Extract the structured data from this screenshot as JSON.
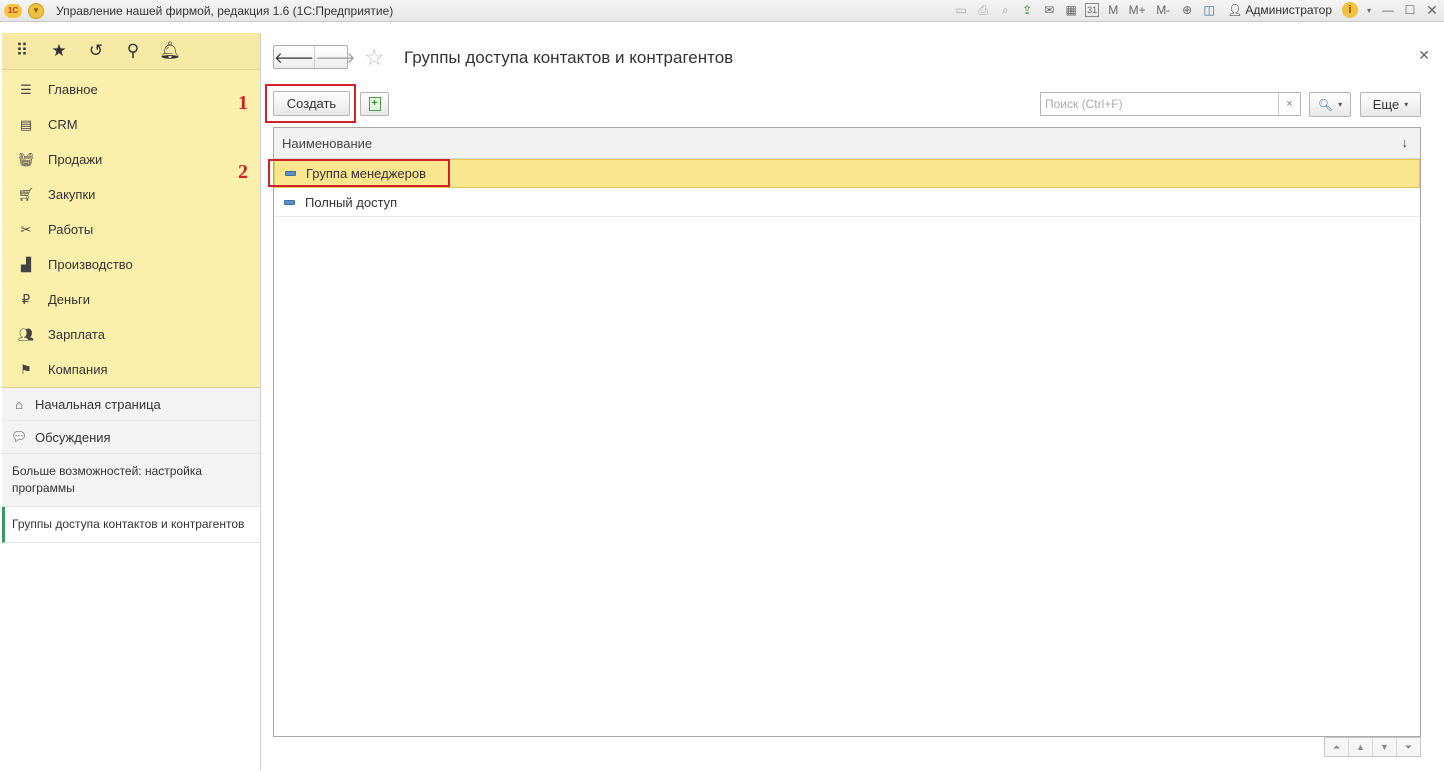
{
  "titlebar": {
    "app_title": "Управление нашей фирмой, редакция 1.6  (1С:Предприятие)",
    "user": "Администратор",
    "icons": [
      "save-icon",
      "print-icon",
      "preview-icon",
      "upload-icon",
      "mail-icon",
      "calculator-icon",
      "calendar-icon",
      "m-icon",
      "m-plus-icon",
      "m-minus-icon",
      "zoom-icon",
      "panels-icon",
      "user-icon",
      "info-icon",
      "minimize-icon",
      "maximize-icon",
      "close-icon"
    ],
    "m_label": "M",
    "m_plus_label": "M+",
    "m_minus_label": "M-",
    "calendar_label": "31"
  },
  "sidebar": {
    "top_icons": [
      "apps-grid-icon",
      "favorites-star-icon",
      "history-icon",
      "search-icon",
      "notifications-bell-icon"
    ],
    "sections": [
      {
        "label": "Главное",
        "icon": "menu-icon"
      },
      {
        "label": "CRM",
        "icon": "crm-card-icon"
      },
      {
        "label": "Продажи",
        "icon": "sales-basket-icon"
      },
      {
        "label": "Закупки",
        "icon": "purchases-cart-icon"
      },
      {
        "label": "Работы",
        "icon": "tools-icon"
      },
      {
        "label": "Производство",
        "icon": "factory-icon"
      },
      {
        "label": "Деньги",
        "icon": "ruble-icon"
      },
      {
        "label": "Зарплата",
        "icon": "people-icon"
      },
      {
        "label": "Компания",
        "icon": "flag-icon"
      }
    ],
    "nav": {
      "home": "Начальная страница",
      "discussions": "Обсуждения"
    },
    "open_windows": [
      {
        "label": "Больше возможностей: настройка программы"
      },
      {
        "label": "Группы доступа контактов и контрагентов"
      }
    ]
  },
  "form": {
    "title": "Группы доступа контактов и контрагентов",
    "create_label": "Создать",
    "search_placeholder": "Поиск (Ctrl+F)",
    "clear_label": "×",
    "more_label": "Еще",
    "column_header": "Наименование",
    "sort_label": "↓",
    "rows": [
      {
        "name": "Группа менеджеров",
        "selected": true
      },
      {
        "name": "Полный доступ",
        "selected": false
      }
    ],
    "annotation_1": "1",
    "annotation_2": "2"
  }
}
